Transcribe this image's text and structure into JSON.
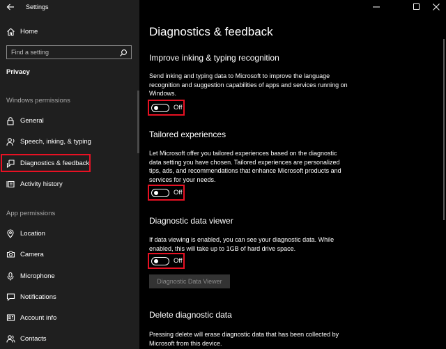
{
  "window": {
    "title": "Settings",
    "controls": [
      "minimize-icon",
      "maximize-icon",
      "close-icon"
    ]
  },
  "sidebar": {
    "home_label": "Home",
    "search_placeholder": "Find a setting",
    "section_title": "Privacy",
    "windows_permissions_header": "Windows permissions",
    "windows_items": [
      {
        "label": "General",
        "icon": "lock-icon"
      },
      {
        "label": "Speech, inking, & typing",
        "icon": "speech-icon"
      },
      {
        "label": "Diagnostics & feedback",
        "icon": "feedback-icon",
        "selected": true
      },
      {
        "label": "Activity history",
        "icon": "activity-history-icon"
      }
    ],
    "app_permissions_header": "App permissions",
    "app_items": [
      {
        "label": "Location",
        "icon": "location-icon"
      },
      {
        "label": "Camera",
        "icon": "camera-icon"
      },
      {
        "label": "Microphone",
        "icon": "microphone-icon"
      },
      {
        "label": "Notifications",
        "icon": "notifications-icon"
      },
      {
        "label": "Account info",
        "icon": "account-info-icon"
      },
      {
        "label": "Contacts",
        "icon": "contacts-icon"
      }
    ]
  },
  "main": {
    "title": "Diagnostics & feedback",
    "sections": [
      {
        "header": "Improve inking & typing recognition",
        "description": "Send inking and typing data to Microsoft to improve the language recognition and suggestion capabilities of apps and services running on Windows.",
        "toggle_state": "Off"
      },
      {
        "header": "Tailored experiences",
        "description": "Let Microsoft offer you tailored experiences based on the diagnostic data setting you have chosen. Tailored experiences are personalized tips, ads, and recommendations that enhance Microsoft products and services for your needs.",
        "toggle_state": "Off"
      },
      {
        "header": "Diagnostic data viewer",
        "description": "If data viewing is enabled, you can see your diagnostic data. While enabled, this will take up to 1GB of hard drive space.",
        "toggle_state": "Off",
        "button_label": "Diagnostic Data Viewer"
      },
      {
        "header": "Delete diagnostic data",
        "description": "Pressing delete will erase diagnostic data that has been collected by Microsoft from this device."
      }
    ]
  },
  "colors": {
    "highlight": "#e81123",
    "sidebar_bg": "#1f1f1f",
    "main_bg": "#000000"
  }
}
